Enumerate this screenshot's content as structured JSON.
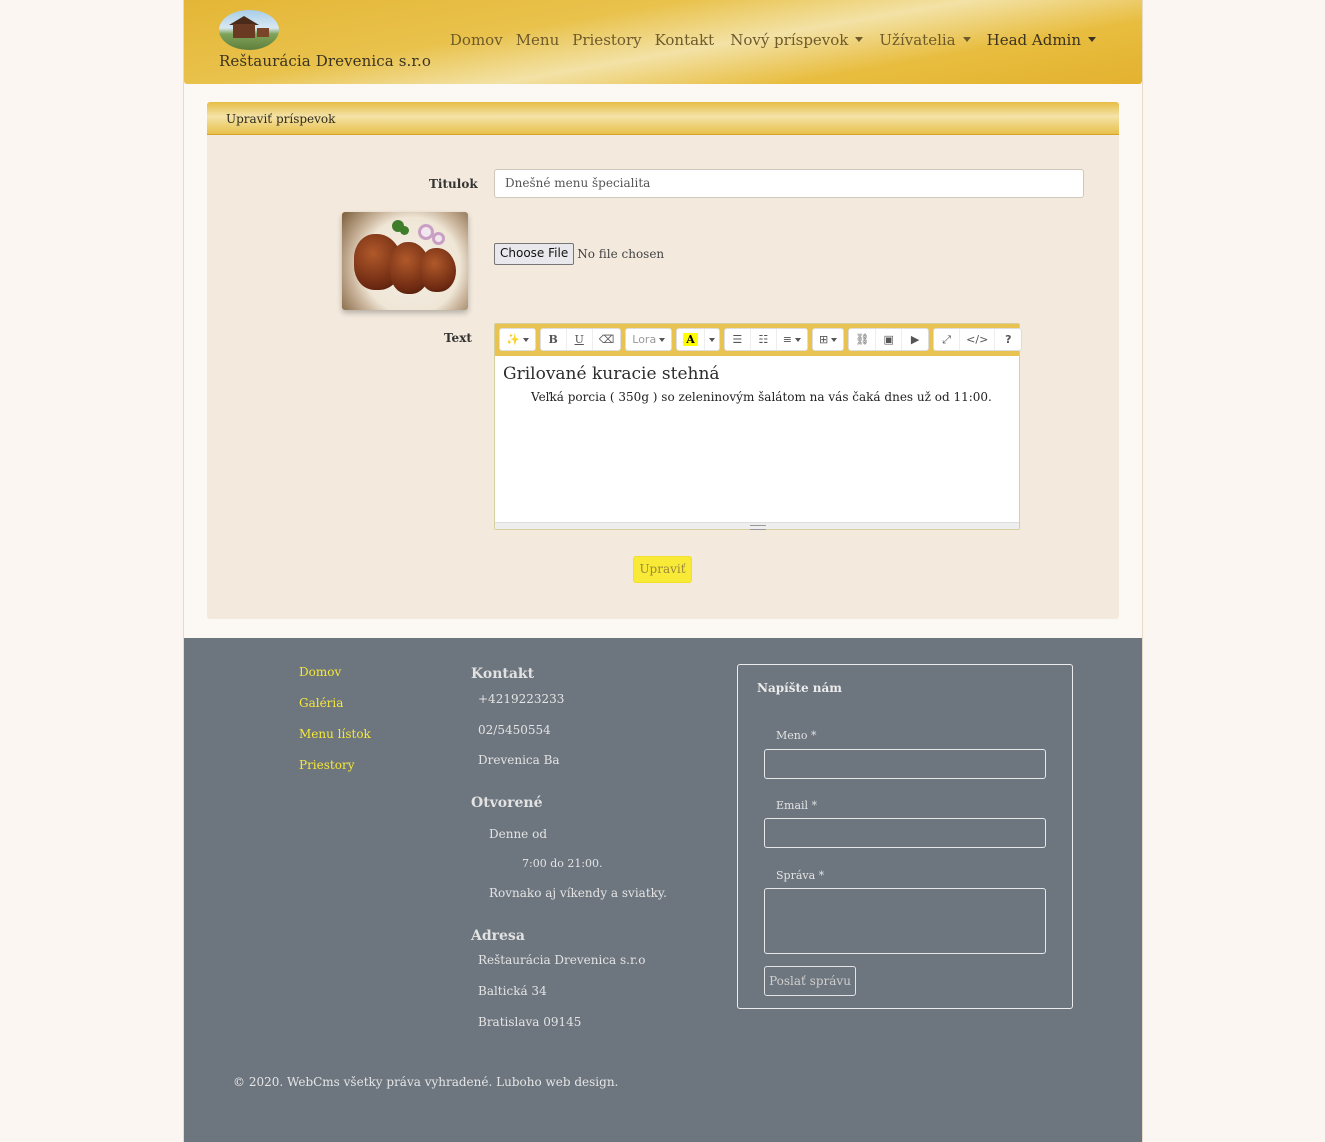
{
  "header": {
    "brand": "Reštaurácia Drevenica s.r.o",
    "nav": {
      "home": "Domov",
      "menu": "Menu",
      "rooms": "Priestory",
      "contact": "Kontakt",
      "new_post": "Nový príspevok",
      "users": "Užívatelia",
      "admin": "Head Admin"
    }
  },
  "card": {
    "header": "Upraviť príspevok",
    "title_label": "Titulok",
    "title_value": "Dnešné menu špecialita",
    "file_button": "Choose File",
    "file_status": "No file chosen",
    "text_label": "Text",
    "editor": {
      "font_name": "Lora",
      "highlight_glyph": "A",
      "bold_glyph": "B",
      "underline_glyph": "U",
      "heading": "Grilované kuracie stehná",
      "paragraph": "Veľká porcia ( 350g ) so zeleninovým šalátom na vás čaká dnes už od 11:00."
    },
    "submit": "Upraviť"
  },
  "footer": {
    "links": [
      "Domov",
      "Galéria",
      "Menu lístok",
      "Priestory"
    ],
    "contact": {
      "heading": "Kontakt",
      "phone1": "+4219223233",
      "phone2": "02/5450554",
      "place": "Drevenica Ba"
    },
    "open": {
      "heading": "Otvorené",
      "line1": "Denne od",
      "line2": "7:00 do 21:00.",
      "line3": "Rovnako aj víkendy a sviatky."
    },
    "address": {
      "heading": "Adresa",
      "line1": "Reštaurácia Drevenica s.r.o",
      "line2": "Baltická 34",
      "line3": "Bratislava 09145"
    },
    "form": {
      "title": "Napíšte nám",
      "name_label": "Meno *",
      "email_label": "Email *",
      "message_label": "Správa *",
      "send": "Poslať správu"
    },
    "copyright": "© 2020. WebCms všetky práva vyhradené. Luboho web design."
  }
}
